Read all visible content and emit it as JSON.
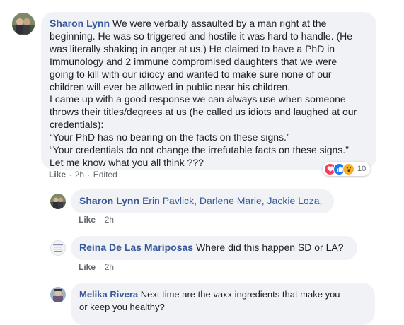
{
  "comment": {
    "author": "Sharon Lynn",
    "lines": [
      "We were verbally assaulted by a man right at the",
      "beginning. He was so triggered and hostile it was hard to handle. (He",
      "was literally shaking in anger at us.) He claimed to have a PhD in",
      "Immunology and 2 immune compromised daughters that we were",
      "going to kill with our idiocy and wanted to make sure none of our",
      "children will ever be allowed in public near his children.",
      "I came up with a good response we can always use when someone",
      "throws their titles/degrees at us (he called us idiots and laughed at our",
      "credentials):",
      "“Your PhD has no bearing on the facts on these signs.”",
      "“Your credentials do not change the irrefutable facts on these signs.”",
      "Let me know what you all think ???"
    ],
    "like": "Like",
    "time": "2h",
    "edited": "Edited",
    "reaction_count": "10",
    "reaction_icons": [
      "love-icon",
      "like-icon",
      "wow-icon"
    ]
  },
  "replies": [
    {
      "author": "Sharon Lynn",
      "text": "Erin Pavlick, Darlene Marie, Jackie Loza,",
      "like": "Like",
      "time": "2h"
    },
    {
      "author": "Reina De Las Mariposas",
      "text": "Where did this happen SD or LA?",
      "like": "Like",
      "time": "2h"
    },
    {
      "author": "Melika Rivera",
      "lines": [
        "Next time are the vaxx ingredients that make you",
        "or keep you healthy?"
      ]
    }
  ],
  "colors": {
    "author_link": "#385898",
    "bubble_bg": "#f0f2f5",
    "text": "#1c1e21",
    "meta": "#65676b",
    "like_blue": "#1877f2",
    "love_red": "#f33e58",
    "wow_yellow": "#f7b125"
  }
}
